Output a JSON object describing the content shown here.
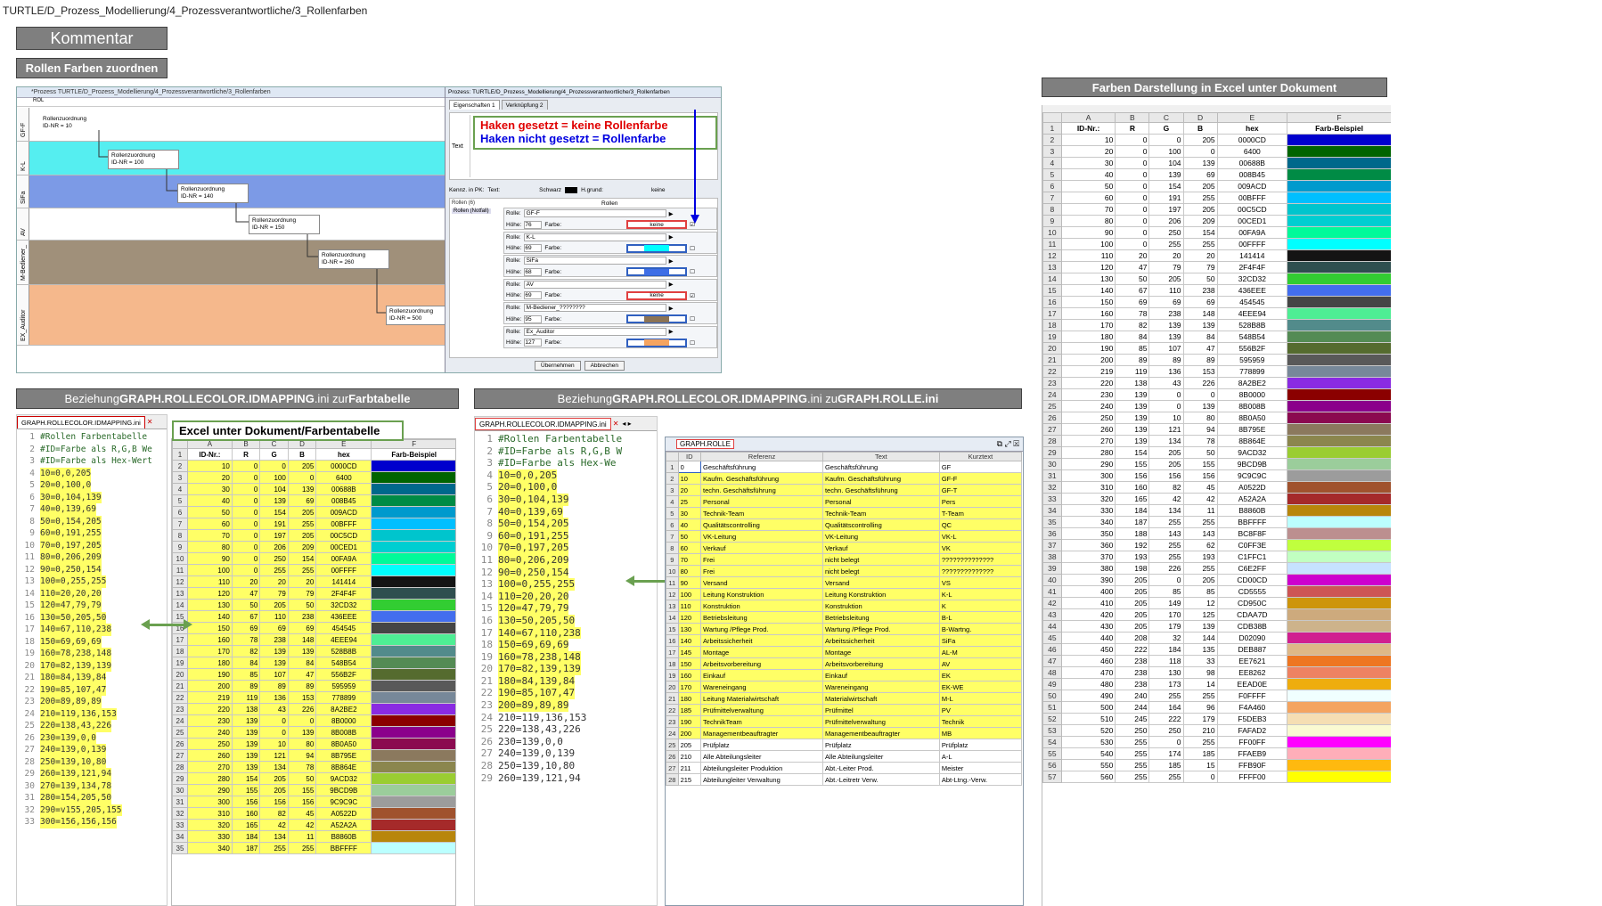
{
  "breadcrumb": "TURTLE/D_Prozess_Modellierung/4_Prozessverantwortliche/3_Rollenfarben",
  "comment_button": "Kommentar",
  "rollen_header": "Rollen Farben zuordnen",
  "farben_header": "Farben Darstellung in Excel unter Dokument",
  "proc_title": "*Prozess TURTLE/D_Prozess_Modellierung/4_Prozessverantwortliche/3_Rollenfarben",
  "proc_sub": "ROL",
  "lanes": [
    {
      "label": "GF-F",
      "color": "#ffffff"
    },
    {
      "label": "K-L",
      "color": "#55eef0"
    },
    {
      "label": "SiFa",
      "color": "#7c9ae6"
    },
    {
      "label": "AV",
      "color": "#ffffff"
    },
    {
      "label": "M-Bediener_",
      "color": "#a0907a"
    },
    {
      "label": "EX_Auditor",
      "color": "#f5b88c"
    }
  ],
  "boxes": [
    {
      "t": "Rollenzuordnung",
      "id": "ID-NR = 10"
    },
    {
      "t": "Rollenzuordnung",
      "id": "ID-NR = 100"
    },
    {
      "t": "Rollenzuordnung",
      "id": "ID-NR = 140"
    },
    {
      "t": "Rollenzuordnung",
      "id": "ID-NR = 150"
    },
    {
      "t": "Rollenzuordnung",
      "id": "ID-NR = 260"
    },
    {
      "t": "Rollenzuordnung",
      "id": "ID-NR = 500"
    }
  ],
  "dialog": {
    "title": "Prozess: TURTLE/D_Prozess_Modellierung/4_Prozessverantwortliche/3_Rollenfarben",
    "tab1": "Eigenschaften 1",
    "tab2": "Verknüpfung 2",
    "text_label": "Text",
    "red": "Haken gesetzt = keine Rollenfarbe",
    "blue": "Haken nicht gesetzt = Rollenfarbe",
    "kennz": "Kennz. in PK:",
    "text2": "Text:",
    "schwarz": "Schwarz",
    "hgrund": "H.grund:",
    "keine": "keine",
    "rollen_head": "Rollen",
    "rollen_count": "Rollen (6)",
    "rollen_notfall": "Rollen (Notfall)",
    "rolle": "Rolle:",
    "hoehe": "Höhe:",
    "farbe": "Farbe:",
    "ok": "Übernehmen",
    "cancel": "Abbrechen",
    "rows": [
      {
        "name": "GF-F",
        "h": "76",
        "color": "",
        "keine": true
      },
      {
        "name": "K-L",
        "h": "69",
        "color": "#00ffff",
        "keine": false
      },
      {
        "name": "SiFa",
        "h": "68",
        "color": "#3e6ee6",
        "keine": false
      },
      {
        "name": "AV",
        "h": "69",
        "color": "",
        "keine": true
      },
      {
        "name": "M-Bediener_????????",
        "h": "95",
        "color": "#8b7355",
        "keine": false
      },
      {
        "name": "Ex_Auditor",
        "h": "127",
        "color": "#f5a460",
        "keine": false
      }
    ]
  },
  "header_left": {
    "pre": "Beziehung ",
    "b1": "GRAPH.ROLLECOLOR.IDMAPPING",
    "mid": ".ini zur ",
    "b2": "Farbtabelle"
  },
  "header_right": {
    "pre": "Beziehung ",
    "b1": "GRAPH.ROLLECOLOR.IDMAPPING",
    "mid": ".ini zu ",
    "b2": "GRAPH.ROLLE.ini"
  },
  "ini_tab": "GRAPH.ROLLECOLOR.IDMAPPING.ini",
  "excel_label": "Excel unter Dokument/Farbentabelle",
  "ini_lines_left": [
    "#Rollen Farbentabelle",
    "#ID=Farbe als R,G,B We",
    "#ID=Farbe als Hex-Wert",
    "10=0,0,205",
    "20=0,100,0",
    "30=0,104,139",
    "40=0,139,69",
    "50=0,154,205",
    "60=0,191,255",
    "70=0,197,205",
    "80=0,206,209",
    "90=0,250,154",
    "100=0,255,255",
    "110=20,20,20",
    "120=47,79,79",
    "130=50,205,50",
    "140=67,110,238",
    "150=69,69,69",
    "160=78,238,148",
    "170=82,139,139",
    "180=84,139,84",
    "190=85,107,47",
    "200=89,89,89",
    "210=119,136,153",
    "220=138,43,226",
    "230=139,0,0",
    "240=139,0,139",
    "250=139,10,80",
    "260=139,121,94",
    "270=139,134,78",
    "280=154,205,50",
    "290=v155,205,155",
    "300=156,156,156"
  ],
  "ini_lines_right": [
    "#Rollen Farbentabelle",
    "#ID=Farbe als R,G,B W",
    "#ID=Farbe als Hex-We",
    "10=0,0,205",
    "20=0,100,0",
    "30=0,104,139",
    "40=0,139,69",
    "50=0,154,205",
    "60=0,191,255",
    "70=0,197,205",
    "80=0,206,209",
    "90=0,250,154",
    "100=0,255,255",
    "110=20,20,20",
    "120=47,79,79",
    "130=50,205,50",
    "140=67,110,238",
    "150=69,69,69",
    "160=78,238,148",
    "170=82,139,139",
    "180=84,139,84",
    "190=85,107,47",
    "200=89,89,89",
    "210=119,136,153",
    "220=138,43,226",
    "230=139,0,0",
    "240=139,0,139",
    "250=139,10,80",
    "260=139,121,94"
  ],
  "colors": [
    [
      10,
      0,
      0,
      205,
      "0000CD"
    ],
    [
      20,
      0,
      100,
      0,
      "6400"
    ],
    [
      30,
      0,
      104,
      139,
      "00688B"
    ],
    [
      40,
      0,
      139,
      69,
      "008B45"
    ],
    [
      50,
      0,
      154,
      205,
      "009ACD"
    ],
    [
      60,
      0,
      191,
      255,
      "00BFFF"
    ],
    [
      70,
      0,
      197,
      205,
      "00C5CD"
    ],
    [
      80,
      0,
      206,
      209,
      "00CED1"
    ],
    [
      90,
      0,
      250,
      154,
      "00FA9A"
    ],
    [
      100,
      0,
      255,
      255,
      "00FFFF"
    ],
    [
      110,
      20,
      20,
      20,
      "141414"
    ],
    [
      120,
      47,
      79,
      79,
      "2F4F4F"
    ],
    [
      130,
      50,
      205,
      50,
      "32CD32"
    ],
    [
      140,
      67,
      110,
      238,
      "436EEE"
    ],
    [
      150,
      69,
      69,
      69,
      "454545"
    ],
    [
      160,
      78,
      238,
      148,
      "4EEE94"
    ],
    [
      170,
      82,
      139,
      139,
      "528B8B"
    ],
    [
      180,
      84,
      139,
      84,
      "548B54"
    ],
    [
      190,
      85,
      107,
      47,
      "556B2F"
    ],
    [
      200,
      89,
      89,
      89,
      "595959"
    ],
    [
      219,
      119,
      136,
      153,
      "778899"
    ],
    [
      220,
      138,
      43,
      226,
      "8A2BE2"
    ],
    [
      230,
      139,
      0,
      0,
      "8B0000"
    ],
    [
      240,
      139,
      0,
      139,
      "8B008B"
    ],
    [
      250,
      139,
      10,
      80,
      "8B0A50"
    ],
    [
      260,
      139,
      121,
      94,
      "8B795E"
    ],
    [
      270,
      139,
      134,
      78,
      "8B864E"
    ],
    [
      280,
      154,
      205,
      50,
      "9ACD32"
    ],
    [
      290,
      155,
      205,
      155,
      "9BCD9B"
    ],
    [
      300,
      156,
      156,
      156,
      "9C9C9C"
    ],
    [
      310,
      160,
      82,
      45,
      "A0522D"
    ],
    [
      320,
      165,
      42,
      42,
      "A52A2A"
    ],
    [
      330,
      184,
      134,
      11,
      "B8860B"
    ],
    [
      340,
      187,
      255,
      255,
      "BBFFFF"
    ],
    [
      350,
      188,
      143,
      143,
      "BC8F8F"
    ],
    [
      360,
      192,
      255,
      62,
      "C0FF3E"
    ],
    [
      370,
      193,
      255,
      193,
      "C1FFC1"
    ],
    [
      380,
      198,
      226,
      255,
      "C6E2FF"
    ],
    [
      390,
      205,
      0,
      205,
      "CD00CD"
    ],
    [
      400,
      205,
      85,
      85,
      "CD5555"
    ],
    [
      410,
      205,
      149,
      12,
      "CD950C"
    ],
    [
      420,
      205,
      170,
      125,
      "CDAA7D"
    ],
    [
      430,
      205,
      179,
      139,
      "CDB38B"
    ],
    [
      440,
      208,
      32,
      144,
      "D02090"
    ],
    [
      450,
      222,
      184,
      135,
      "DEB887"
    ],
    [
      460,
      238,
      118,
      33,
      "EE7621"
    ],
    [
      470,
      238,
      130,
      98,
      "EE8262"
    ],
    [
      480,
      238,
      173,
      14,
      "EEAD0E"
    ],
    [
      490,
      240,
      255,
      255,
      "F0FFFF"
    ],
    [
      500,
      244,
      164,
      96,
      "F4A460"
    ],
    [
      510,
      245,
      222,
      179,
      "F5DEB3"
    ],
    [
      520,
      250,
      250,
      210,
      "FAFAD2"
    ],
    [
      530,
      255,
      0,
      255,
      "FF00FF"
    ],
    [
      540,
      255,
      174,
      185,
      "FFAEB9"
    ],
    [
      550,
      255,
      185,
      15,
      "FFB90F"
    ],
    [
      560,
      255,
      255,
      0,
      "FFFF00"
    ]
  ],
  "excel_cols": [
    "A",
    "B",
    "C",
    "D",
    "E",
    "F"
  ],
  "excel_head": [
    "ID-Nr.:",
    "R",
    "G",
    "B",
    "hex",
    "Farb-Beispiel"
  ],
  "rolle_window": "GRAPH.ROLLE",
  "rolle_cols": [
    "ID",
    "Referenz",
    "Text",
    "Kurztext"
  ],
  "rolle_rows": [
    [
      "0",
      "Geschäftsführung",
      "Geschäftsführung",
      "GF"
    ],
    [
      "10",
      "Kaufm. Geschäftsführung",
      "Kaufm. Geschäftsführung",
      "GF-F"
    ],
    [
      "20",
      "techn. Geschäftsführung",
      "techn. Geschäftsführung",
      "GF-T"
    ],
    [
      "25",
      "Personal",
      "Personal",
      "Pers"
    ],
    [
      "30",
      "Technik-Team",
      "Technik-Team",
      "T-Team"
    ],
    [
      "40",
      "Qualitätscontrolling",
      "Qualitätscontrolling",
      "QC"
    ],
    [
      "50",
      "VK-Leitung",
      "VK-Leitung",
      "VK-L"
    ],
    [
      "60",
      "Verkauf",
      "Verkauf",
      "VK"
    ],
    [
      "70",
      "Frei",
      "nicht belegt",
      "??????????????"
    ],
    [
      "80",
      "Frei",
      "nicht belegt",
      "??????????????"
    ],
    [
      "90",
      "Versand",
      "Versand",
      "VS"
    ],
    [
      "100",
      "Leitung Konstruktion",
      "Leitung Konstruktion",
      "K-L"
    ],
    [
      "110",
      "Konstruktion",
      "Konstruktion",
      "K"
    ],
    [
      "120",
      "Betriebsleitung",
      "Betriebsleitung",
      "B-L"
    ],
    [
      "130",
      "Wartung /Pflege Prod.",
      "Wartung /Pflege Prod.",
      "B-Wartng."
    ],
    [
      "140",
      "Arbeitssicherheit",
      "Arbeitssicherheit",
      "SiFa"
    ],
    [
      "145",
      "Montage",
      "Montage",
      "AL-M"
    ],
    [
      "150",
      "Arbeitsvorbereitung",
      "Arbeitsvorbereitung",
      "AV"
    ],
    [
      "160",
      "Einkauf",
      "Einkauf",
      "EK"
    ],
    [
      "170",
      "Wareneingang",
      "Wareneingang",
      "EK-WE"
    ],
    [
      "180",
      "Leitung Materialwirtschaft",
      "Materialwirtschaft",
      "M-L"
    ],
    [
      "185",
      "Prüfmittelverwaltung",
      "Prüfmittel",
      "PV"
    ],
    [
      "190",
      "TechnikTeam",
      "Prüfmittelverwaltung",
      "Technik"
    ],
    [
      "200",
      "Managementbeauftragter",
      "Managementbeauftragter",
      "MB"
    ],
    [
      "205",
      "Prüfplatz",
      "Prüfplatz",
      "Prüfplatz"
    ],
    [
      "210",
      "Alle Abteilungsleiter",
      "Alle Abteilungsleiter",
      "A-L"
    ],
    [
      "211",
      "Abteilungsleiter Produktion",
      "Abt.-Leiter Prod.",
      "Meister"
    ],
    [
      "215",
      "Abteilungleiter Verwaltung",
      "Abt.-Leitretr Verw.",
      "Abt-Ltng.-Verw."
    ]
  ]
}
